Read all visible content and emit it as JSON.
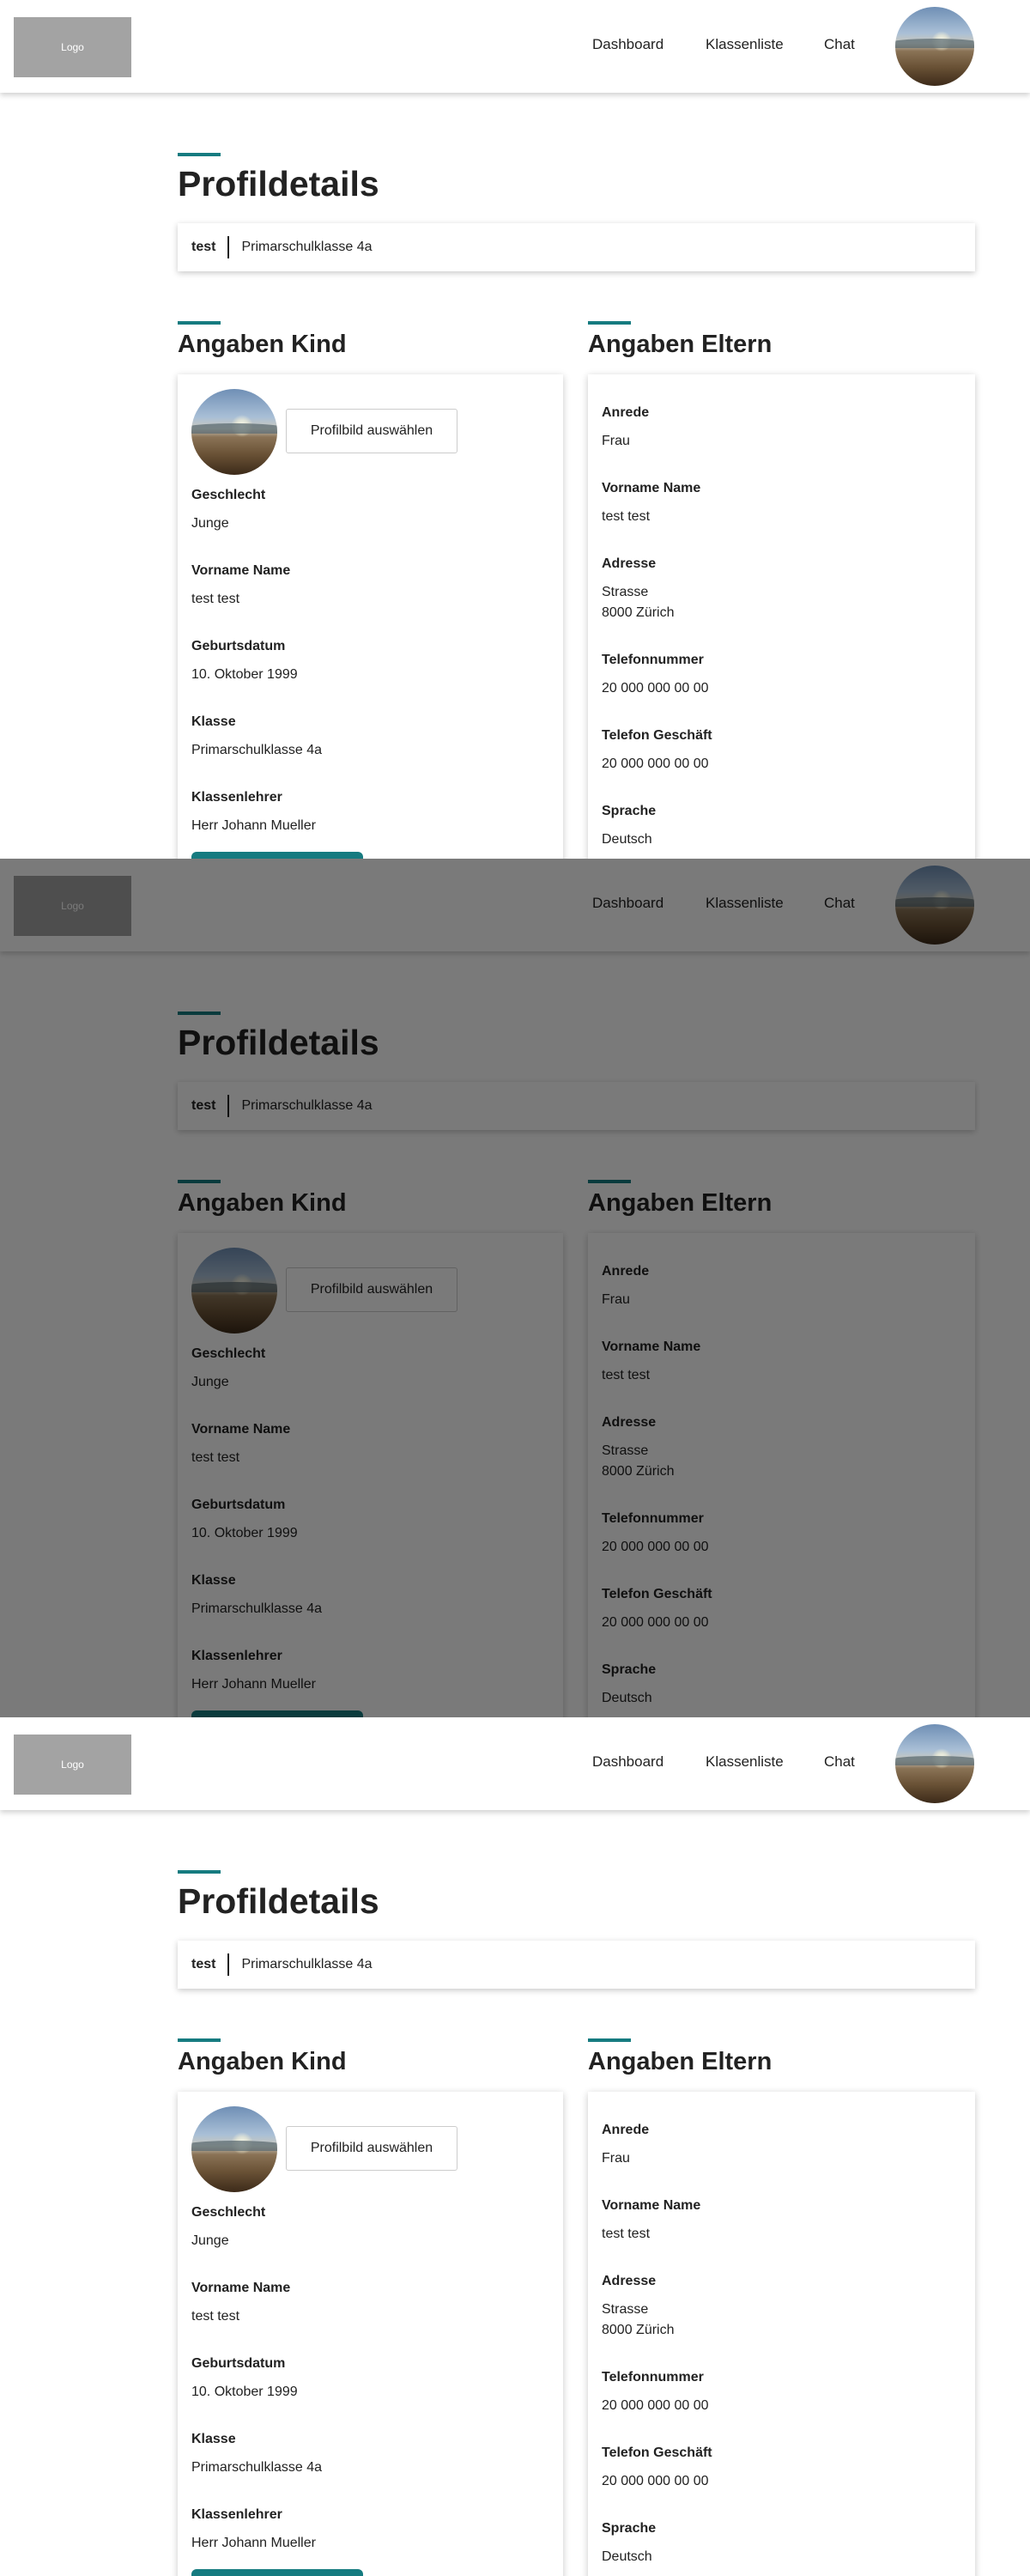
{
  "header": {
    "logo_label": "Logo",
    "nav": [
      {
        "label": "Dashboard"
      },
      {
        "label": "Klassenliste"
      },
      {
        "label": "Chat"
      }
    ]
  },
  "page": {
    "title": "Profildetails",
    "info_bar": {
      "name": "test",
      "class": "Primarschulklasse 4a"
    }
  },
  "kind": {
    "title": "Angaben Kind",
    "select_image_label": "Profilbild auswählen",
    "fields": [
      {
        "label": "Geschlecht",
        "value": "Junge"
      },
      {
        "label": "Vorname Name",
        "value": "test test"
      },
      {
        "label": "Geburtsdatum",
        "value": "10. Oktober 1999"
      },
      {
        "label": "Klasse",
        "value": "Primarschulklasse 4a"
      },
      {
        "label": "Klassenlehrer",
        "value": "Herr Johann Mueller"
      }
    ],
    "primary_button_label": ""
  },
  "eltern": {
    "title": "Angaben Eltern",
    "fields": [
      {
        "label": "Anrede",
        "value": "Frau"
      },
      {
        "label": "Vorname Name",
        "value": "test test"
      },
      {
        "label": "Adresse",
        "value_lines": [
          "Strasse",
          "8000 Zürich"
        ]
      },
      {
        "label": "Telefonnummer",
        "value": "20 000 000 00 00"
      },
      {
        "label": "Telefon Geschäft",
        "value": "20 000 000 00 00"
      },
      {
        "label": "Sprache",
        "value": "Deutsch"
      }
    ]
  },
  "colors": {
    "accent": "#167b80",
    "logo_bg": "#a3a3a3",
    "modal_overlay": "rgba(0,0,0,0.52)"
  },
  "icons": {
    "profile_image": "landscape-avatar-image"
  }
}
